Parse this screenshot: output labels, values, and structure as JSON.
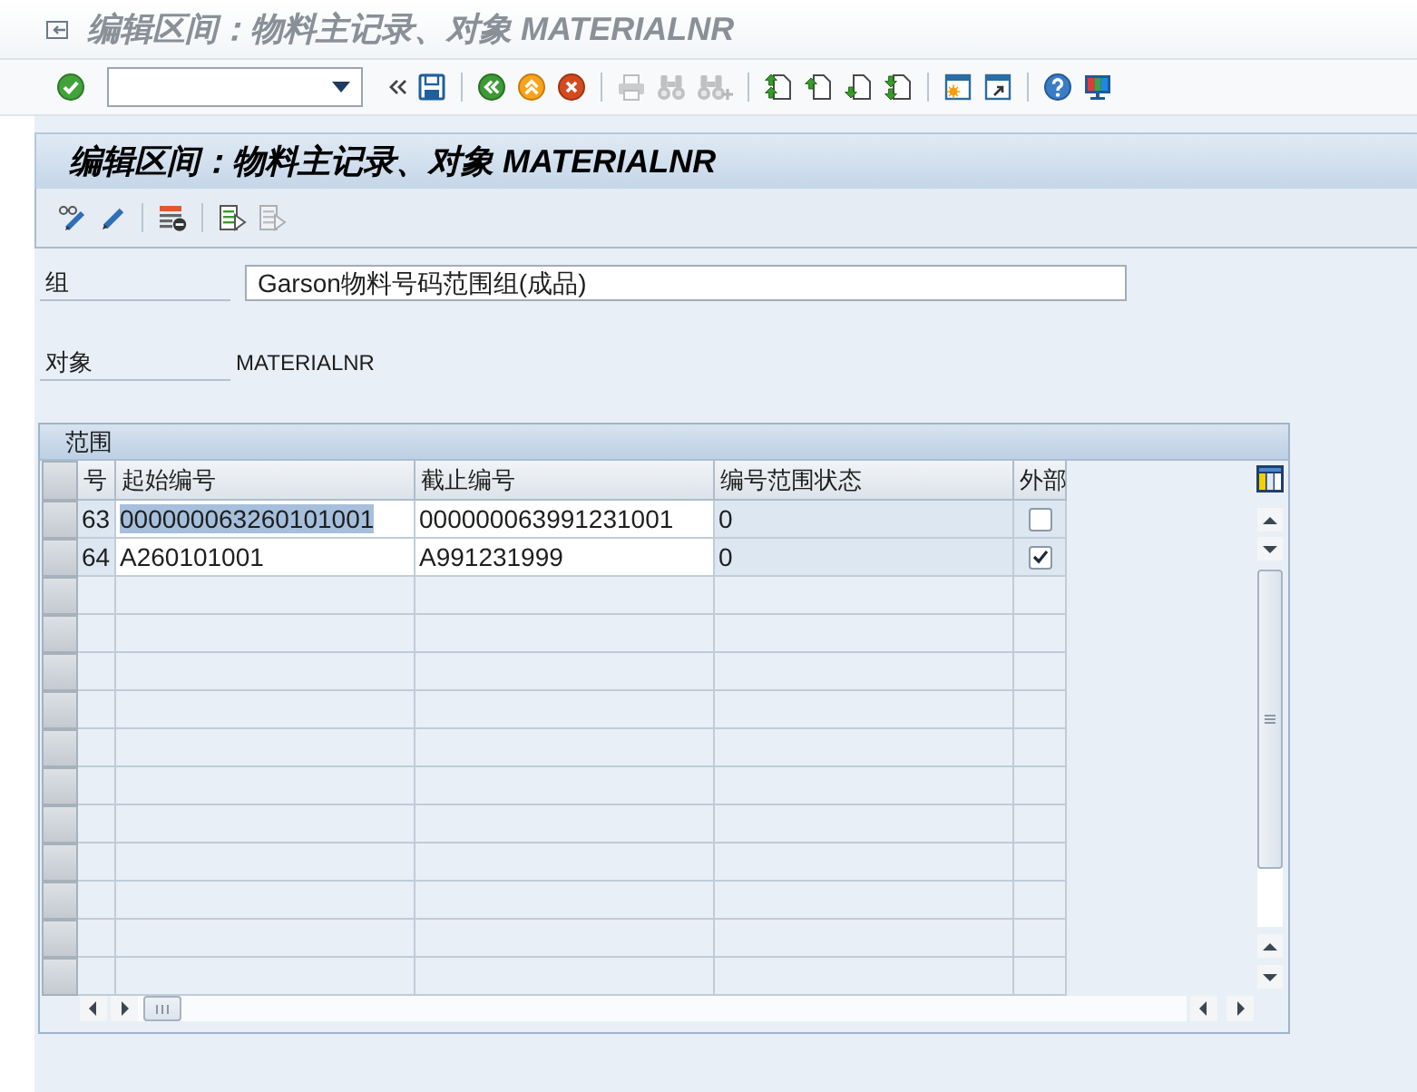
{
  "window_title": "编辑区间：物料主记录、对象 MATERIALNR",
  "standard_toolbar": [
    {
      "buttons": [
        {
          "kind": "enter",
          "disabled": false
        },
        {
          "kind": "command_field",
          "disabled": false
        },
        {
          "kind": "collapse",
          "disabled": false
        },
        {
          "kind": "save",
          "disabled": false
        }
      ]
    },
    {
      "buttons": [
        {
          "kind": "back",
          "disabled": false
        },
        {
          "kind": "exit",
          "disabled": false
        },
        {
          "kind": "cancel",
          "disabled": false
        }
      ]
    },
    {
      "buttons": [
        {
          "kind": "print",
          "disabled": true
        },
        {
          "kind": "find",
          "disabled": true
        },
        {
          "kind": "find_next",
          "disabled": true
        }
      ]
    },
    {
      "buttons": [
        {
          "kind": "first_page",
          "disabled": false
        },
        {
          "kind": "previous_page",
          "disabled": false
        },
        {
          "kind": "next_page",
          "disabled": false
        },
        {
          "kind": "last_page",
          "disabled": false
        }
      ]
    },
    {
      "buttons": [
        {
          "kind": "new_session",
          "disabled": false
        },
        {
          "kind": "shortcut",
          "disabled": false
        }
      ]
    },
    {
      "buttons": [
        {
          "kind": "help",
          "disabled": false
        },
        {
          "kind": "layout",
          "disabled": false
        }
      ]
    }
  ],
  "screen_title": "编辑区间：物料主记录、对象 MATERIALNR",
  "application_toolbar": [
    {
      "buttons": [
        {
          "kind": "glasses_pencil",
          "disabled": false
        },
        {
          "kind": "pencil",
          "disabled": false
        }
      ]
    },
    {
      "buttons": [
        {
          "kind": "list_minus",
          "disabled": false
        }
      ]
    },
    {
      "buttons": [
        {
          "kind": "doc_arrow",
          "disabled": false
        },
        {
          "kind": "doc_arrow",
          "disabled": true
        }
      ]
    }
  ],
  "fields": [
    {
      "label": "组",
      "kind": "input",
      "value": "Garson物料号码范围组(成品)"
    },
    {
      "label": "对象",
      "kind": "text",
      "value": "MATERIALNR"
    }
  ],
  "table": {
    "title": "范围",
    "columns": [
      "号",
      "起始编号",
      "截止编号",
      "编号范围状态",
      "外部"
    ],
    "rows": [
      {
        "number": "63",
        "from": "000000063260101001",
        "to": "000000063991231001",
        "status": "0",
        "external": false,
        "from_highlighted": true
      },
      {
        "number": "64",
        "from": "A260101001",
        "to": "A991231999",
        "status": "0",
        "external": true,
        "from_highlighted": false
      }
    ]
  }
}
